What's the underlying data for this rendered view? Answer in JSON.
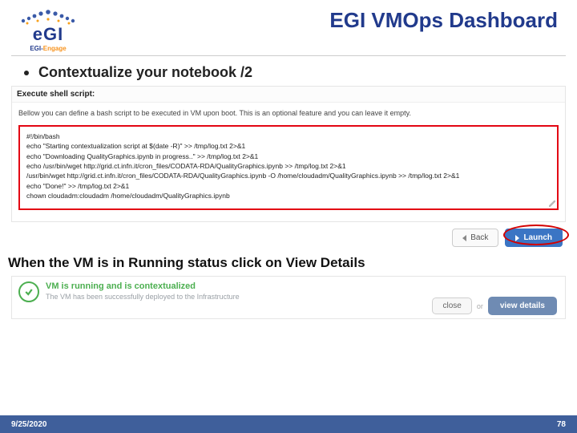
{
  "header": {
    "logo_main": "eGI",
    "logo_sub_e": "EGI-",
    "logo_sub_g": "Engage",
    "title": "EGI VMOps Dashboard"
  },
  "bullet_text": "Contextualize your notebook /2",
  "shot1": {
    "section_label": "Execute shell script:",
    "intro": "Bellow you can define a bash script to be executed in VM upon boot. This is an optional feature and you can leave it empty.",
    "script": "#!/bin/bash\necho \"Starting contextualization script at $(date -R)\" >> /tmp/log.txt 2>&1\necho \"Downloading QualityGraphics.ipynb in progress..\" >> /tmp/log.txt 2>&1\necho /usr/bin/wget http://grid.ct.infn.it/cron_files/CODATA-RDA/QualityGraphics.ipynb >> /tmp/log.txt 2>&1\n/usr/bin/wget http://grid.ct.infn.it/cron_files/CODATA-RDA/QualityGraphics.ipynb -O /home/cloudadm/QualityGraphics.ipynb >> /tmp/log.txt 2>&1\necho \"Done!\" >> /tmp/log.txt 2>&1\nchown cloudadm:cloudadm /home/cloudadm/QualityGraphics.ipynb",
    "back_label": "Back",
    "launch_label": "Launch"
  },
  "mid_text": "When the VM is in Running status click on View Details",
  "shot2": {
    "status_title": "VM is running and is contextualized",
    "status_sub": "The VM has been successfully deployed to the Infrastructure",
    "close_label": "close",
    "or_label": "or",
    "view_label": "view details"
  },
  "footer": {
    "date": "9/25/2020",
    "page": "78"
  }
}
